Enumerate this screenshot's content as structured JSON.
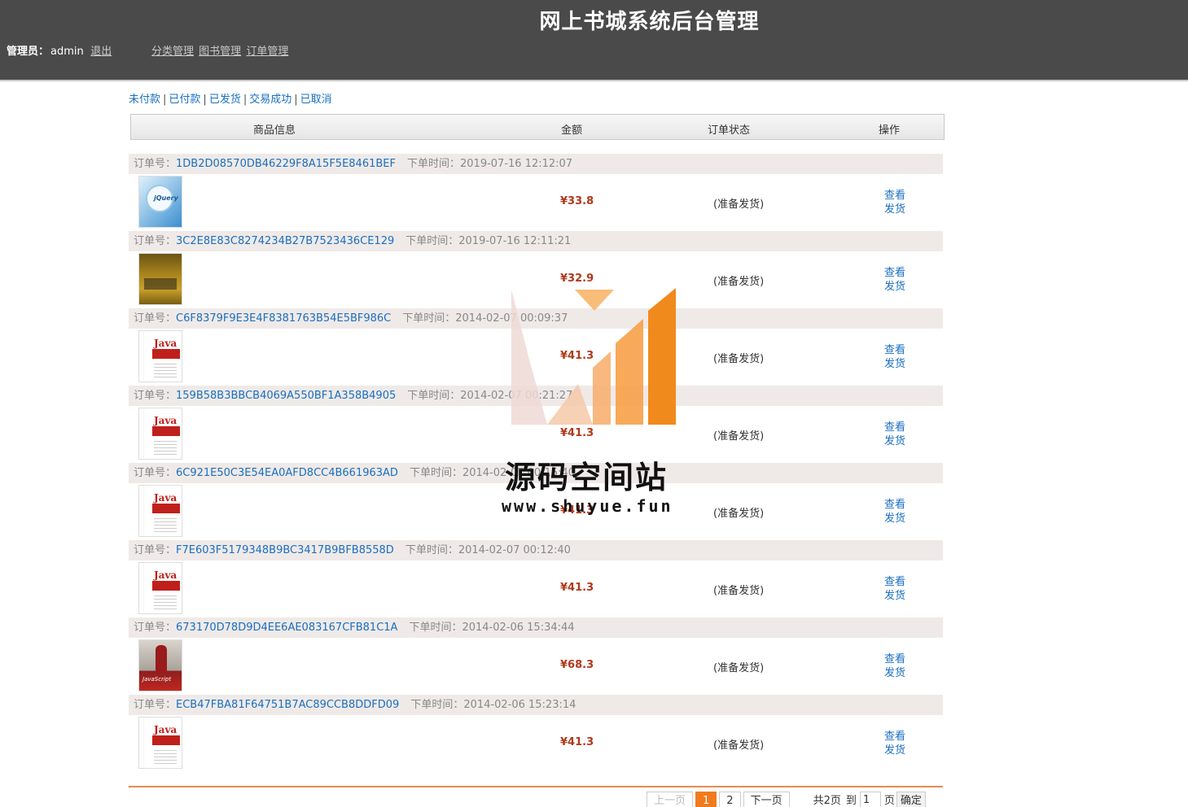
{
  "header": {
    "title": "网上书城系统后台管理",
    "admin_label": "管理员：",
    "admin_name": "admin",
    "logout": "退出",
    "nav": [
      "分类管理",
      "图书管理",
      "订单管理"
    ]
  },
  "filters": [
    "未付款",
    "已付款",
    "已发货",
    "交易成功",
    "已取消"
  ],
  "filter_sep": "|",
  "table_header": {
    "goods": "商品信息",
    "amount": "金额",
    "status": "订单状态",
    "ops": "操作"
  },
  "labels": {
    "order_no": "订单号：",
    "order_time": "下单时间：",
    "view": "查看",
    "ship": "发货"
  },
  "orders": [
    {
      "id": "1DB2D08570DB46229F8A15F5E8461BEF",
      "time": "2019-07-16 12:12:07",
      "amount": "¥33.8",
      "status": "(准备发货)",
      "cover": "jquery-book-cover"
    },
    {
      "id": "3C2E8E83C8274234B27B7523436CE129",
      "time": "2019-07-16 12:11:21",
      "amount": "¥32.9",
      "status": "(准备发货)",
      "cover": "html-book-cover"
    },
    {
      "id": "C6F8379F9E3E4F8381763B54E5BF986C",
      "time": "2014-02-07 00:09:37",
      "amount": "¥41.3",
      "status": "(准备发货)",
      "cover": "java-book-cover"
    },
    {
      "id": "159B58B3BBCB4069A550BF1A358B4905",
      "time": "2014-02-07 00:21:27",
      "amount": "¥41.3",
      "status": "(准备发货)",
      "cover": "java-book-cover"
    },
    {
      "id": "6C921E50C3E54EA0AFD8CC4B661963AD",
      "time": "2014-02-07 00:15:40",
      "amount": "¥41.3",
      "status": "(准备发货)",
      "cover": "java-book-cover"
    },
    {
      "id": "F7E603F5179348B9BC3417B9BFB8558D",
      "time": "2014-02-07 00:12:40",
      "amount": "¥41.3",
      "status": "(准备发货)",
      "cover": "java-book-cover"
    },
    {
      "id": "673170D78D9D4EE6AE083167CFB81C1A",
      "time": "2014-02-06 15:34:44",
      "amount": "¥68.3",
      "status": "(准备发货)",
      "cover": "javascript-book-cover"
    },
    {
      "id": "ECB47FBA81F64751B7AC89CCB8DDFD09",
      "time": "2014-02-06 15:23:14",
      "amount": "¥41.3",
      "status": "(准备发货)",
      "cover": "java-book-cover"
    }
  ],
  "cover_text": {
    "java": "Java",
    "jquery": "jQuery",
    "javascript": "JavaScript"
  },
  "pagination": {
    "prev": "上一页",
    "pages": [
      "1",
      "2"
    ],
    "current": "1",
    "next": "下一页",
    "total": "共2页",
    "goto": "到",
    "page_value": "1",
    "page_unit": "页",
    "confirm": "确定"
  },
  "watermark": {
    "name": "源码空间站",
    "url": "www.shuyue.fun"
  }
}
